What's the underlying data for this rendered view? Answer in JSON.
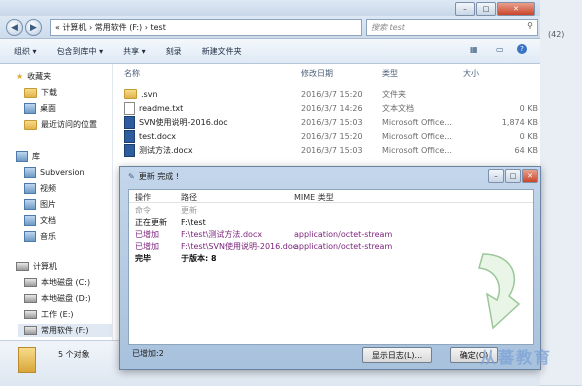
{
  "explorer": {
    "address": "« 计算机 › 常用软件 (F:) › test",
    "search_placeholder": "搜索 test",
    "toolbar": [
      "组织 ▾",
      "包含到库中 ▾",
      "共享 ▾",
      "刻录",
      "新建文件夹"
    ],
    "nav": {
      "favorites": "收藏夹",
      "fav_items": [
        "下载",
        "桌面",
        "最近访问的位置"
      ],
      "libraries": "库",
      "lib_items": [
        "Subversion",
        "视频",
        "图片",
        "文档",
        "音乐"
      ],
      "computer": "计算机",
      "drives": [
        "本地磁盘 (C:)",
        "本地磁盘 (D:)",
        "工作 (E:)",
        "常用软件 (F:)"
      ]
    },
    "columns": {
      "name": "名称",
      "date": "修改日期",
      "type": "类型",
      "size": "大小"
    },
    "files": [
      {
        "name": ".svn",
        "date": "2016/3/7 15:20",
        "type": "文件夹",
        "size": "",
        "icon": "folder-icon"
      },
      {
        "name": "readme.txt",
        "date": "2016/3/7 14:26",
        "type": "文本文档",
        "size": "0 KB",
        "icon": "txt-icon"
      },
      {
        "name": "SVN使用说明-2016.doc",
        "date": "2016/3/7 15:03",
        "type": "Microsoft Office...",
        "size": "1,874 KB",
        "icon": "doc-icon"
      },
      {
        "name": "test.docx",
        "date": "2016/3/7 15:20",
        "type": "Microsoft Office...",
        "size": "0 KB",
        "icon": "doc-icon"
      },
      {
        "name": "测试方法.docx",
        "date": "2016/3/7 15:03",
        "type": "Microsoft Office...",
        "size": "64 KB",
        "icon": "doc-icon"
      }
    ],
    "status": "5 个对象",
    "side_label": "(42)"
  },
  "dialog": {
    "title": "更新 完成 !",
    "columns": {
      "action": "操作",
      "path": "路径",
      "mime": "MIME 类型"
    },
    "rows": [
      {
        "action": "命令",
        "path": "更新",
        "mime": "",
        "color": "#9a9a9a",
        "bold": false
      },
      {
        "action": "正在更新",
        "path": "F:\\test",
        "mime": "",
        "color": "#111111",
        "bold": false
      },
      {
        "action": "已增加",
        "path": "F:\\test\\测试方法.docx",
        "mime": "application/octet-stream",
        "color": "#7a1f7a",
        "bold": false
      },
      {
        "action": "已增加",
        "path": "F:\\test\\SVN使用说明-2016.doc",
        "mime": "application/octet-stream",
        "color": "#7a1f7a",
        "bold": false
      },
      {
        "action": "完毕",
        "path": "于版本: 8",
        "mime": "",
        "color": "#111111",
        "bold": true
      }
    ],
    "status": "已增加:2",
    "show_log_button": "显示日志(L)...",
    "ok_button": "确定(O)",
    "accent": "#4caf50"
  },
  "watermark": "从蕃教育"
}
